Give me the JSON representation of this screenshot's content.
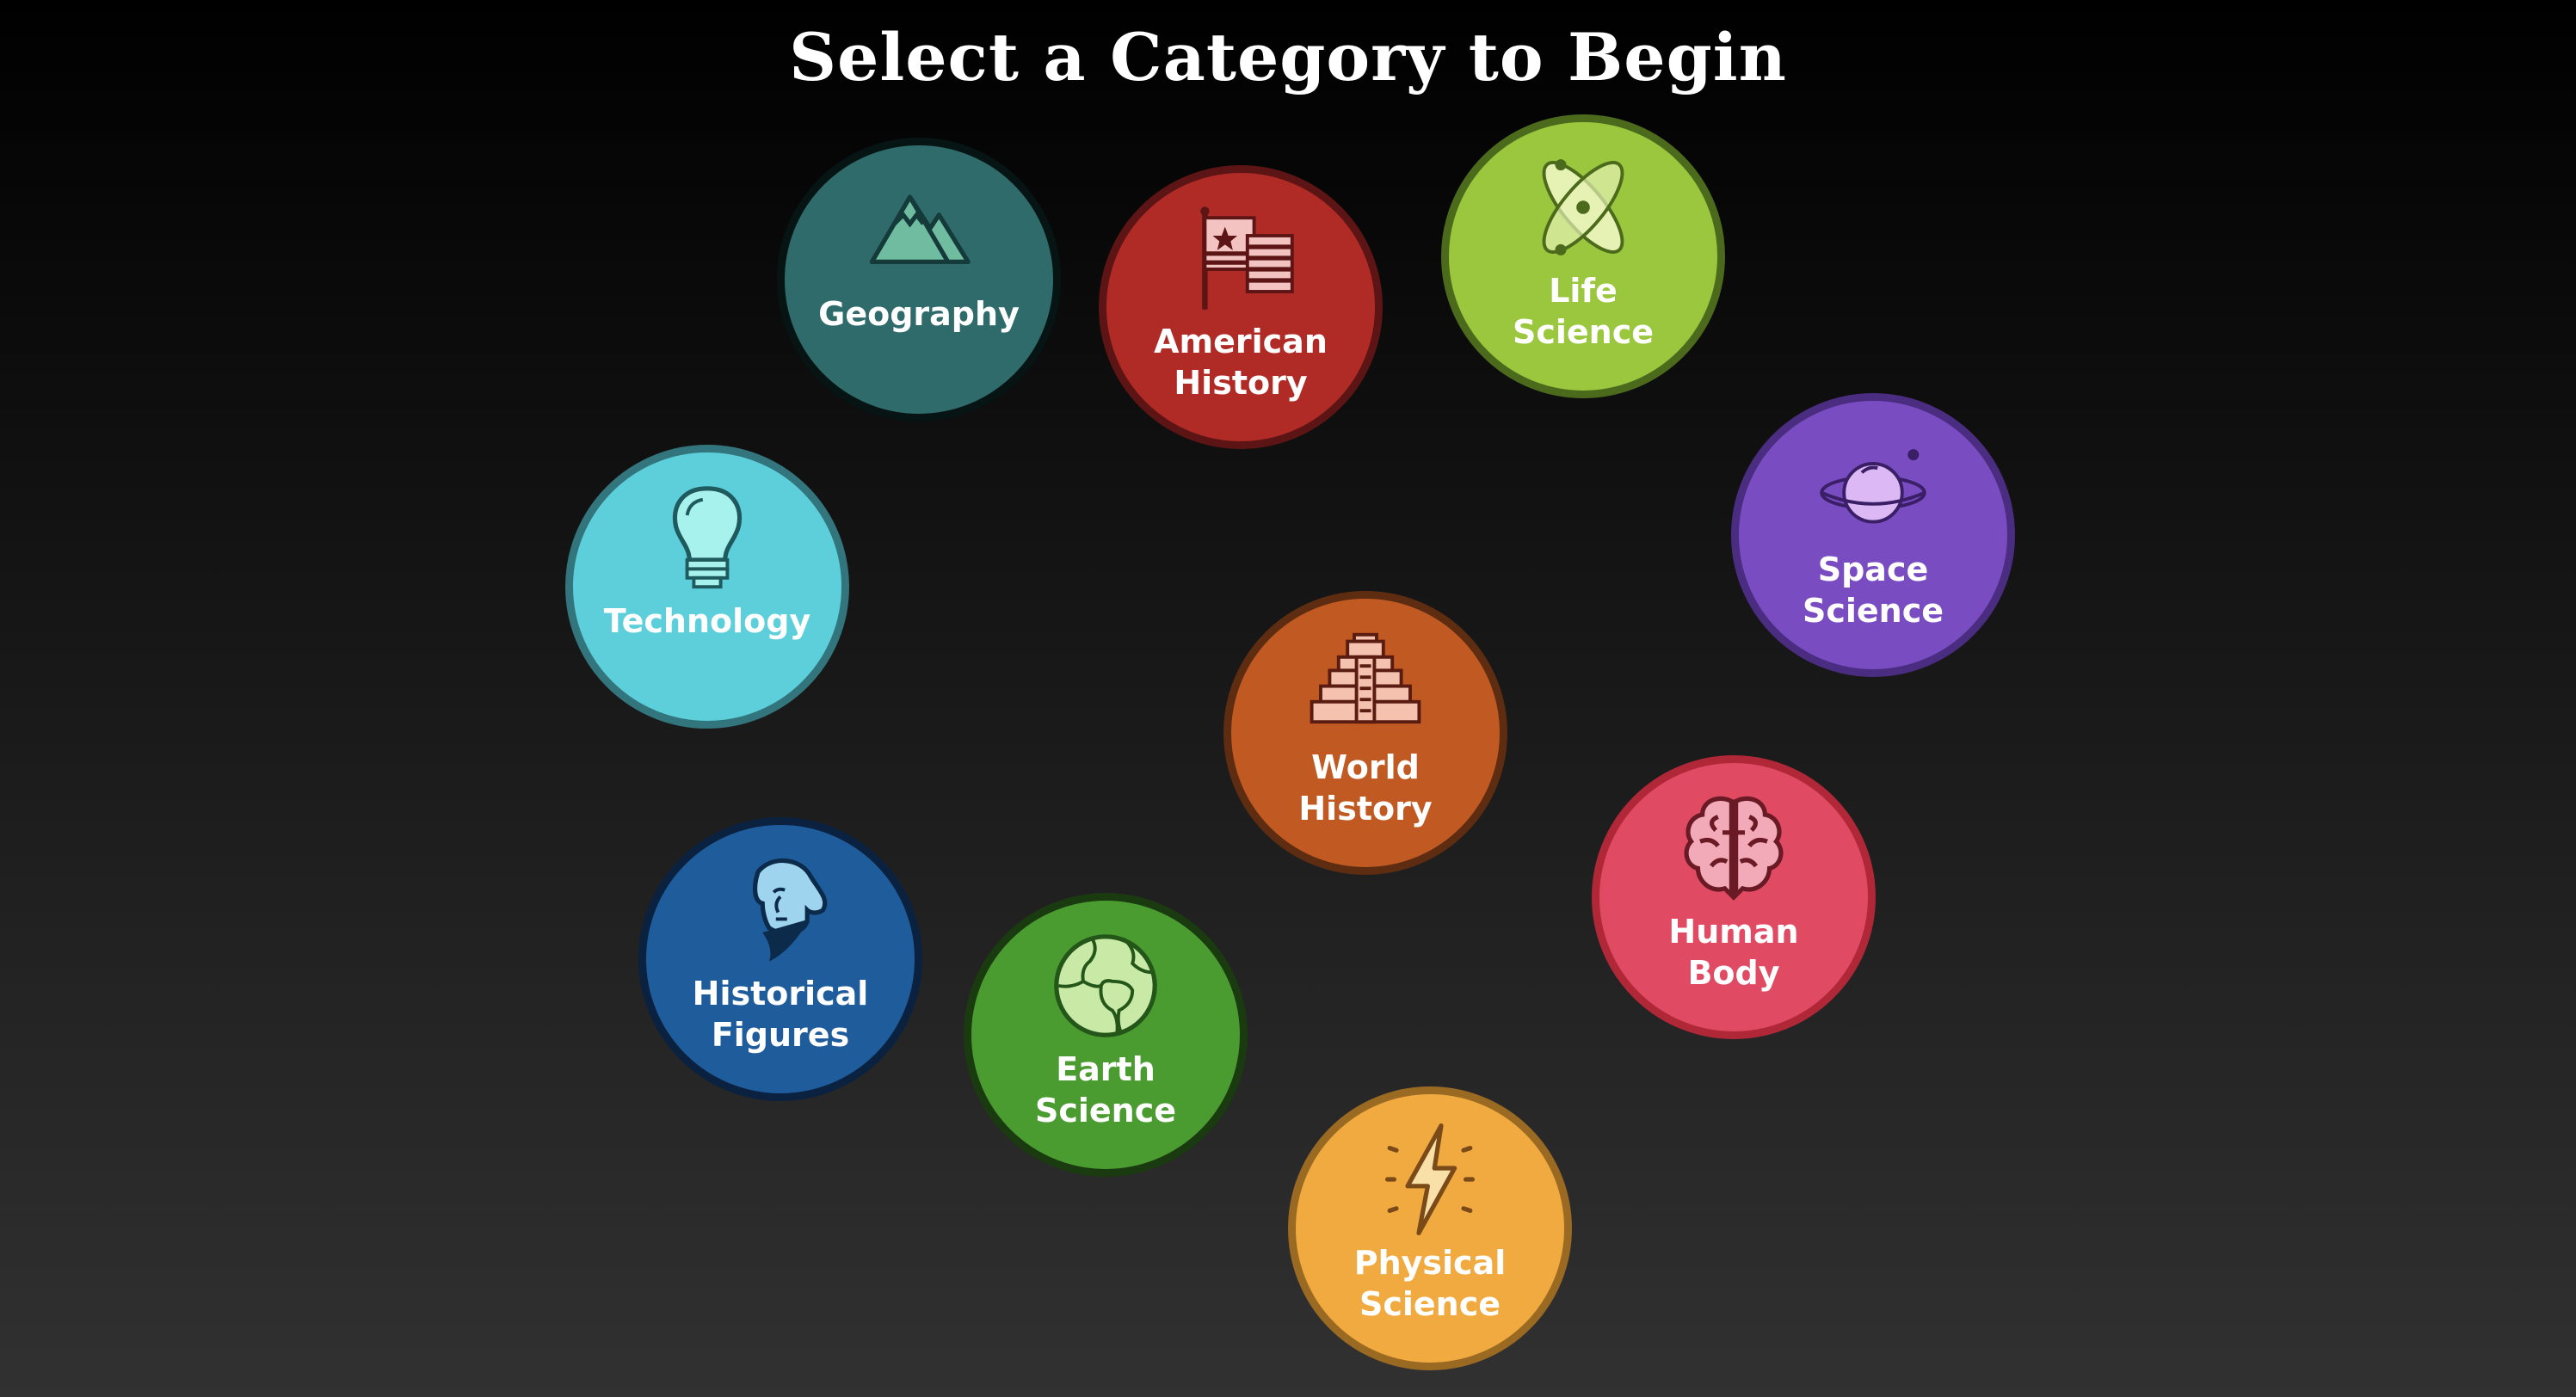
{
  "header": {
    "title": "Select a Category to Begin"
  },
  "categories": [
    {
      "id": "geography",
      "lines": [
        "Geography"
      ],
      "icon": "mountain-icon",
      "fill": "#2e6b6a",
      "border": "#061414",
      "icon_fill": "#6fbca0",
      "icon_stroke": "#153a3a"
    },
    {
      "id": "american-history",
      "lines": [
        "American",
        "History"
      ],
      "icon": "flag-icon",
      "fill": "#b02a26",
      "border": "#5c1514",
      "icon_fill": "#f2c3c0",
      "icon_stroke": "#5c1514"
    },
    {
      "id": "life-science",
      "lines": [
        "Life",
        "Science"
      ],
      "icon": "atom-icon",
      "fill": "#9ac73e",
      "border": "#4c6a1c",
      "icon_fill": "#e6f2b4",
      "icon_stroke": "#4c6a1c"
    },
    {
      "id": "space-science",
      "lines": [
        "Space",
        "Science"
      ],
      "icon": "planet-icon",
      "fill": "#794cc2",
      "border": "#4a2c80",
      "icon_fill": "#dcb8f4",
      "icon_stroke": "#3a1f66"
    },
    {
      "id": "technology",
      "lines": [
        "Technology"
      ],
      "icon": "lightbulb-icon",
      "fill": "#5ccfda",
      "border": "#33757c",
      "icon_fill": "#a8f2ee",
      "icon_stroke": "#1f5a5e"
    },
    {
      "id": "world-history",
      "lines": [
        "World",
        "History"
      ],
      "icon": "pyramid-icon",
      "fill": "#c05a22",
      "border": "#5e2c10",
      "icon_fill": "#f4c2ae",
      "icon_stroke": "#5a1c10"
    },
    {
      "id": "human-body",
      "lines": [
        "Human",
        "Body"
      ],
      "icon": "brain-icon",
      "fill": "#e04a62",
      "border": "#b02838",
      "icon_fill": "#f2aab8",
      "icon_stroke": "#6a1a24"
    },
    {
      "id": "historical-figures",
      "lines": [
        "Historical",
        "Figures"
      ],
      "icon": "portrait-icon",
      "fill": "#1f5c9c",
      "border": "#0a2240",
      "icon_fill": "#9ed4ee",
      "icon_stroke": "#0c2a4a"
    },
    {
      "id": "earth-science",
      "lines": [
        "Earth",
        "Science"
      ],
      "icon": "globe-icon",
      "fill": "#4b9c30",
      "border": "#1a3a10",
      "icon_fill": "#c8eaa6",
      "icon_stroke": "#24561a"
    },
    {
      "id": "physical-science",
      "lines": [
        "Physical",
        "Science"
      ],
      "icon": "lightning-icon",
      "fill": "#f1aa40",
      "border": "#9a6a22",
      "icon_fill": "#f8e0a8",
      "icon_stroke": "#7a4a18"
    }
  ]
}
